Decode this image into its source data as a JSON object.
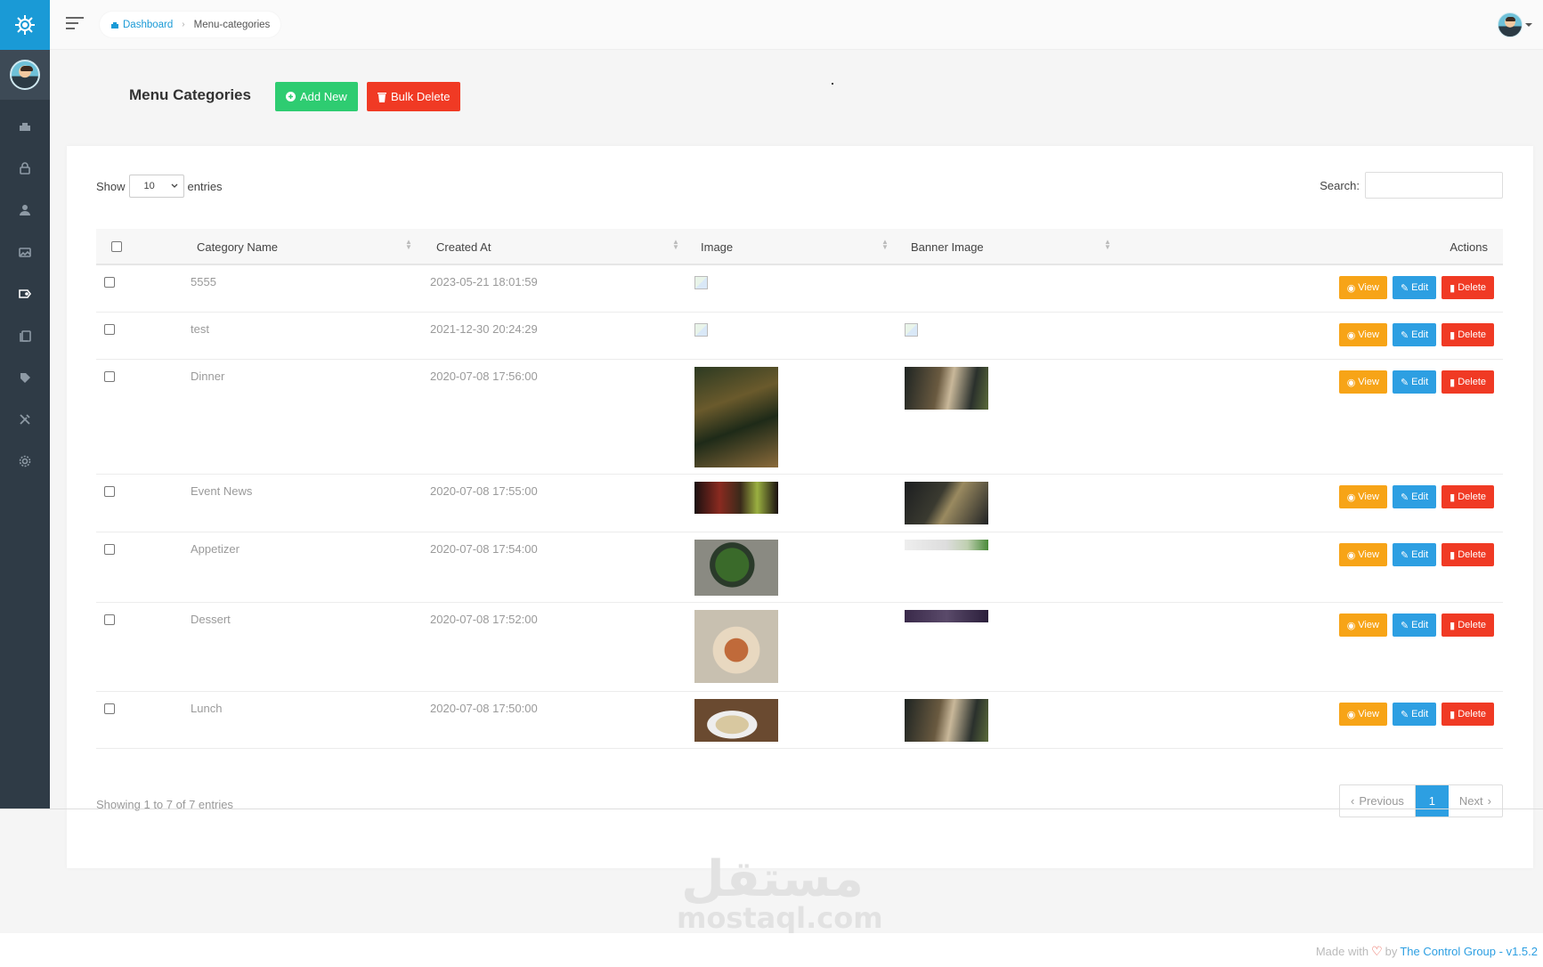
{
  "breadcrumb": {
    "home": "Dashboard",
    "current": "Menu-categories"
  },
  "page": {
    "title": "Menu Categories",
    "add_label": "Add New",
    "bulk_label": "Bulk Delete"
  },
  "table_controls": {
    "show_label": "Show",
    "entries_value": "10",
    "entries_label": "entries",
    "search_label": "Search:"
  },
  "columns": {
    "name": "Category Name",
    "created": "Created At",
    "image": "Image",
    "banner": "Banner Image",
    "actions": "Actions"
  },
  "actions": {
    "view": "View",
    "edit": "Edit",
    "delete": "Delete"
  },
  "rows": [
    {
      "name": "5555",
      "created": "2023-05-21 18:01:59",
      "image": "broken",
      "banner": "none"
    },
    {
      "name": "test",
      "created": "2021-12-30 20:24:29",
      "image": "broken",
      "banner": "broken"
    },
    {
      "name": "Dinner",
      "created": "2020-07-08 17:56:00",
      "image": "restaurant-plants-photo",
      "banner": "dining-table-candles-photo"
    },
    {
      "name": "Event News",
      "created": "2020-07-08 17:55:00",
      "image": "cocktail-fruit-photo",
      "banner": "event-table-photo"
    },
    {
      "name": "Appetizer",
      "created": "2020-07-08 17:54:00",
      "image": "salad-bowl-photo",
      "banner": "herbs-strip-photo"
    },
    {
      "name": "Dessert",
      "created": "2020-07-08 17:52:00",
      "image": "pancake-berries-photo",
      "banner": "purple-strip-photo"
    },
    {
      "name": "Lunch",
      "created": "2020-07-08 17:50:00",
      "image": "pasta-plate-photo",
      "banner": "dining-table-candles-photo"
    }
  ],
  "pagination": {
    "info": "Showing 1 to 7 of 7 entries",
    "previous": "Previous",
    "current": "1",
    "next": "Next"
  },
  "watermark": {
    "arabic": "مستقل",
    "latin": "mostaql.com"
  },
  "footer": {
    "made_with": "Made with",
    "by": "by",
    "company": "The Control Group - v1.5.2"
  },
  "colors": {
    "sidebar": "#2f3b46",
    "brand": "#1a9ad6",
    "success": "#2ecc71",
    "danger": "#f03a24",
    "warning": "#f7a417",
    "info": "#2d9fe2"
  },
  "icons": {
    "sidebar": [
      "dashboard-icon",
      "lock-icon",
      "user-icon",
      "image-icon",
      "tag-icon",
      "copy-icon",
      "tags-icon",
      "tools-icon",
      "gear-icon"
    ]
  }
}
